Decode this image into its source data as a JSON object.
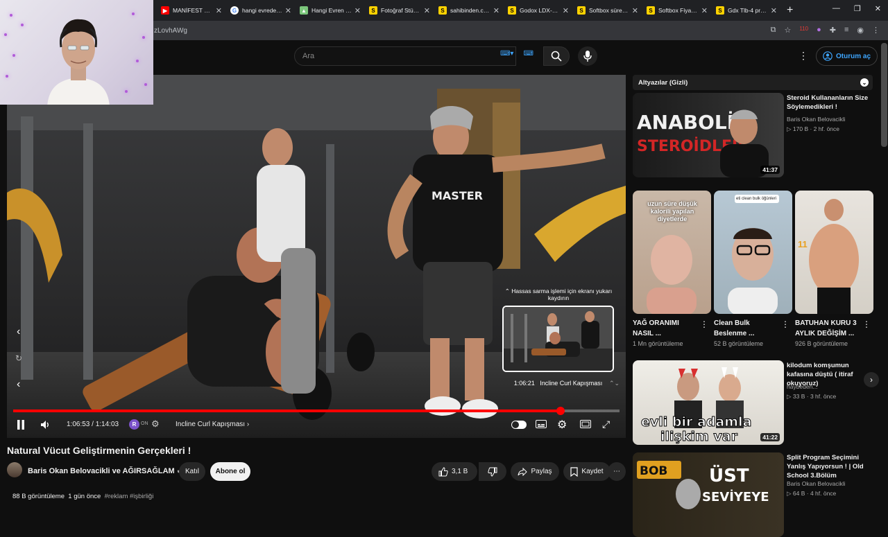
{
  "browser": {
    "tabs": [
      {
        "label": "MANİFEST DR...",
        "fav_color": "#ff0000",
        "fav_text": "▶"
      },
      {
        "label": "hangi evrede d...",
        "fav_color": "#ffffff",
        "fav_text": "G"
      },
      {
        "label": "Hangi Evren D...",
        "fav_color": "#7bc67b",
        "fav_text": "⛰"
      },
      {
        "label": "Fotoğraf Stüdy...",
        "fav_color": "#ffd200",
        "fav_text": "S"
      },
      {
        "label": "sahibinden.com...",
        "fav_color": "#ffd200",
        "fav_text": "S"
      },
      {
        "label": "Godox LDX-55...",
        "fav_color": "#ffd200",
        "fav_text": "S"
      },
      {
        "label": "Softbox sürekli...",
        "fav_color": "#ffd200",
        "fav_text": "S"
      },
      {
        "label": "Softbox Fiyatla...",
        "fav_color": "#ffd200",
        "fav_text": "S"
      },
      {
        "label": "Gdx Tlb-4 pro...",
        "fav_color": "#ffd200",
        "fav_text": "S"
      }
    ],
    "url_fragment": "zLovhAWg",
    "extension_badge": "110"
  },
  "youtube": {
    "search_placeholder": "Ara",
    "signin_label": "Oturum aç"
  },
  "player": {
    "current_time": "1:06:53",
    "duration": "1:14:03",
    "time_separator": " / ",
    "progress_fraction": 0.903,
    "chapter_label": "Incline Curl Kapışması",
    "preview_hint": "Hassas sarma işlemi için ekranı yukarı kaydırın",
    "preview_time": "1:06:21",
    "preview_chapter": "Incline Curl Kapışması",
    "autoplay_badge": "ON"
  },
  "video": {
    "title": "Natural Vücut Geliştirmenin Gerçekleri !",
    "channel": "Baris Okan Belovacikli ve AĞIRSAĞLAM",
    "join_label": "Katıl",
    "subscribe_label": "Abone ol",
    "likes": "3,1 B",
    "share_label": "Paylaş",
    "save_label": "Kaydet",
    "views": "88 B görüntüleme",
    "age": "1 gün önce",
    "tags": "#reklam #işbirliği"
  },
  "sidebar": {
    "chip_label": "Altyazılar (Gizli)",
    "recs": [
      {
        "title": "Steroid Kullananların Size Söylemedikleri !",
        "channel": "Baris Okan Belovacikli",
        "stats": "170 B · 2 hf. önce",
        "duration": "41:37",
        "thumb_text": "ANABOLİK STEROİDLER"
      },
      {
        "title": "kilodum komşumun kafasına düştü ( itiraf okuyoruz)",
        "channel": "haybeden...",
        "stats": "33 B · 3 hf. önce",
        "duration": "41:22",
        "thumb_text": "evli bir adamla ilişkim var"
      },
      {
        "title": "Split Program Seçimini Yanlış Yapıyorsun ! | Old School 3.Bölüm",
        "channel": "Baris Okan Belovacikli",
        "stats": "64 B · 4 hf. önce",
        "duration": "",
        "thumb_text": "ÜST SEVİYEYE"
      }
    ],
    "shorts": [
      {
        "title": "YAĞ ORANIMI NASIL ...",
        "views": "1 Mn görüntüleme",
        "overlay": "uzun süre düşük kalorili yapılan diyetlerde"
      },
      {
        "title": "Clean Bulk Beslenme ...",
        "views": "52 B görüntüleme",
        "overlay": "eti clean bulk öğünleri"
      },
      {
        "title": "BATUHAN KURU 3 AYLIK DEĞİŞİM ...",
        "views": "926 B görüntüleme",
        "overlay": "11"
      }
    ]
  }
}
